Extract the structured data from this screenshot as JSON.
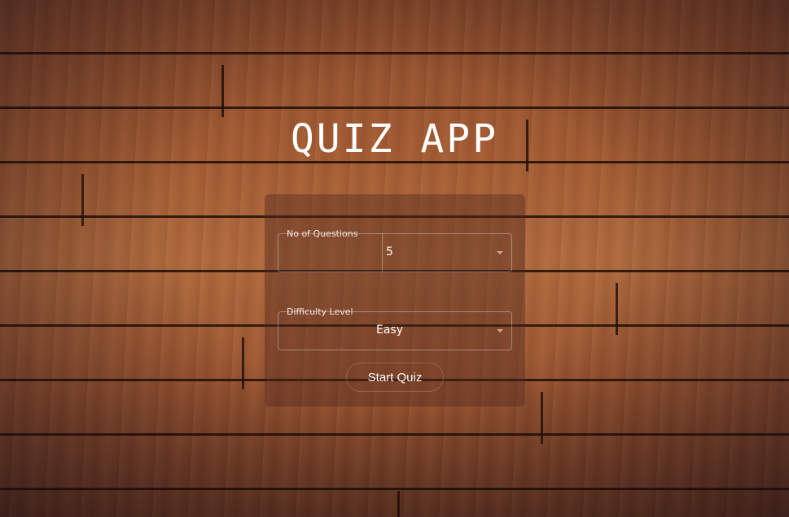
{
  "app": {
    "title": "QUIZ APP"
  },
  "form": {
    "questions": {
      "label": "No of Questions",
      "value": "5"
    },
    "difficulty": {
      "label": "Difficulty Level",
      "value": "Easy"
    },
    "start_label": "Start Quiz"
  },
  "colors": {
    "text": "#ffffff",
    "card": "rgba(80,40,30,0.42)"
  }
}
